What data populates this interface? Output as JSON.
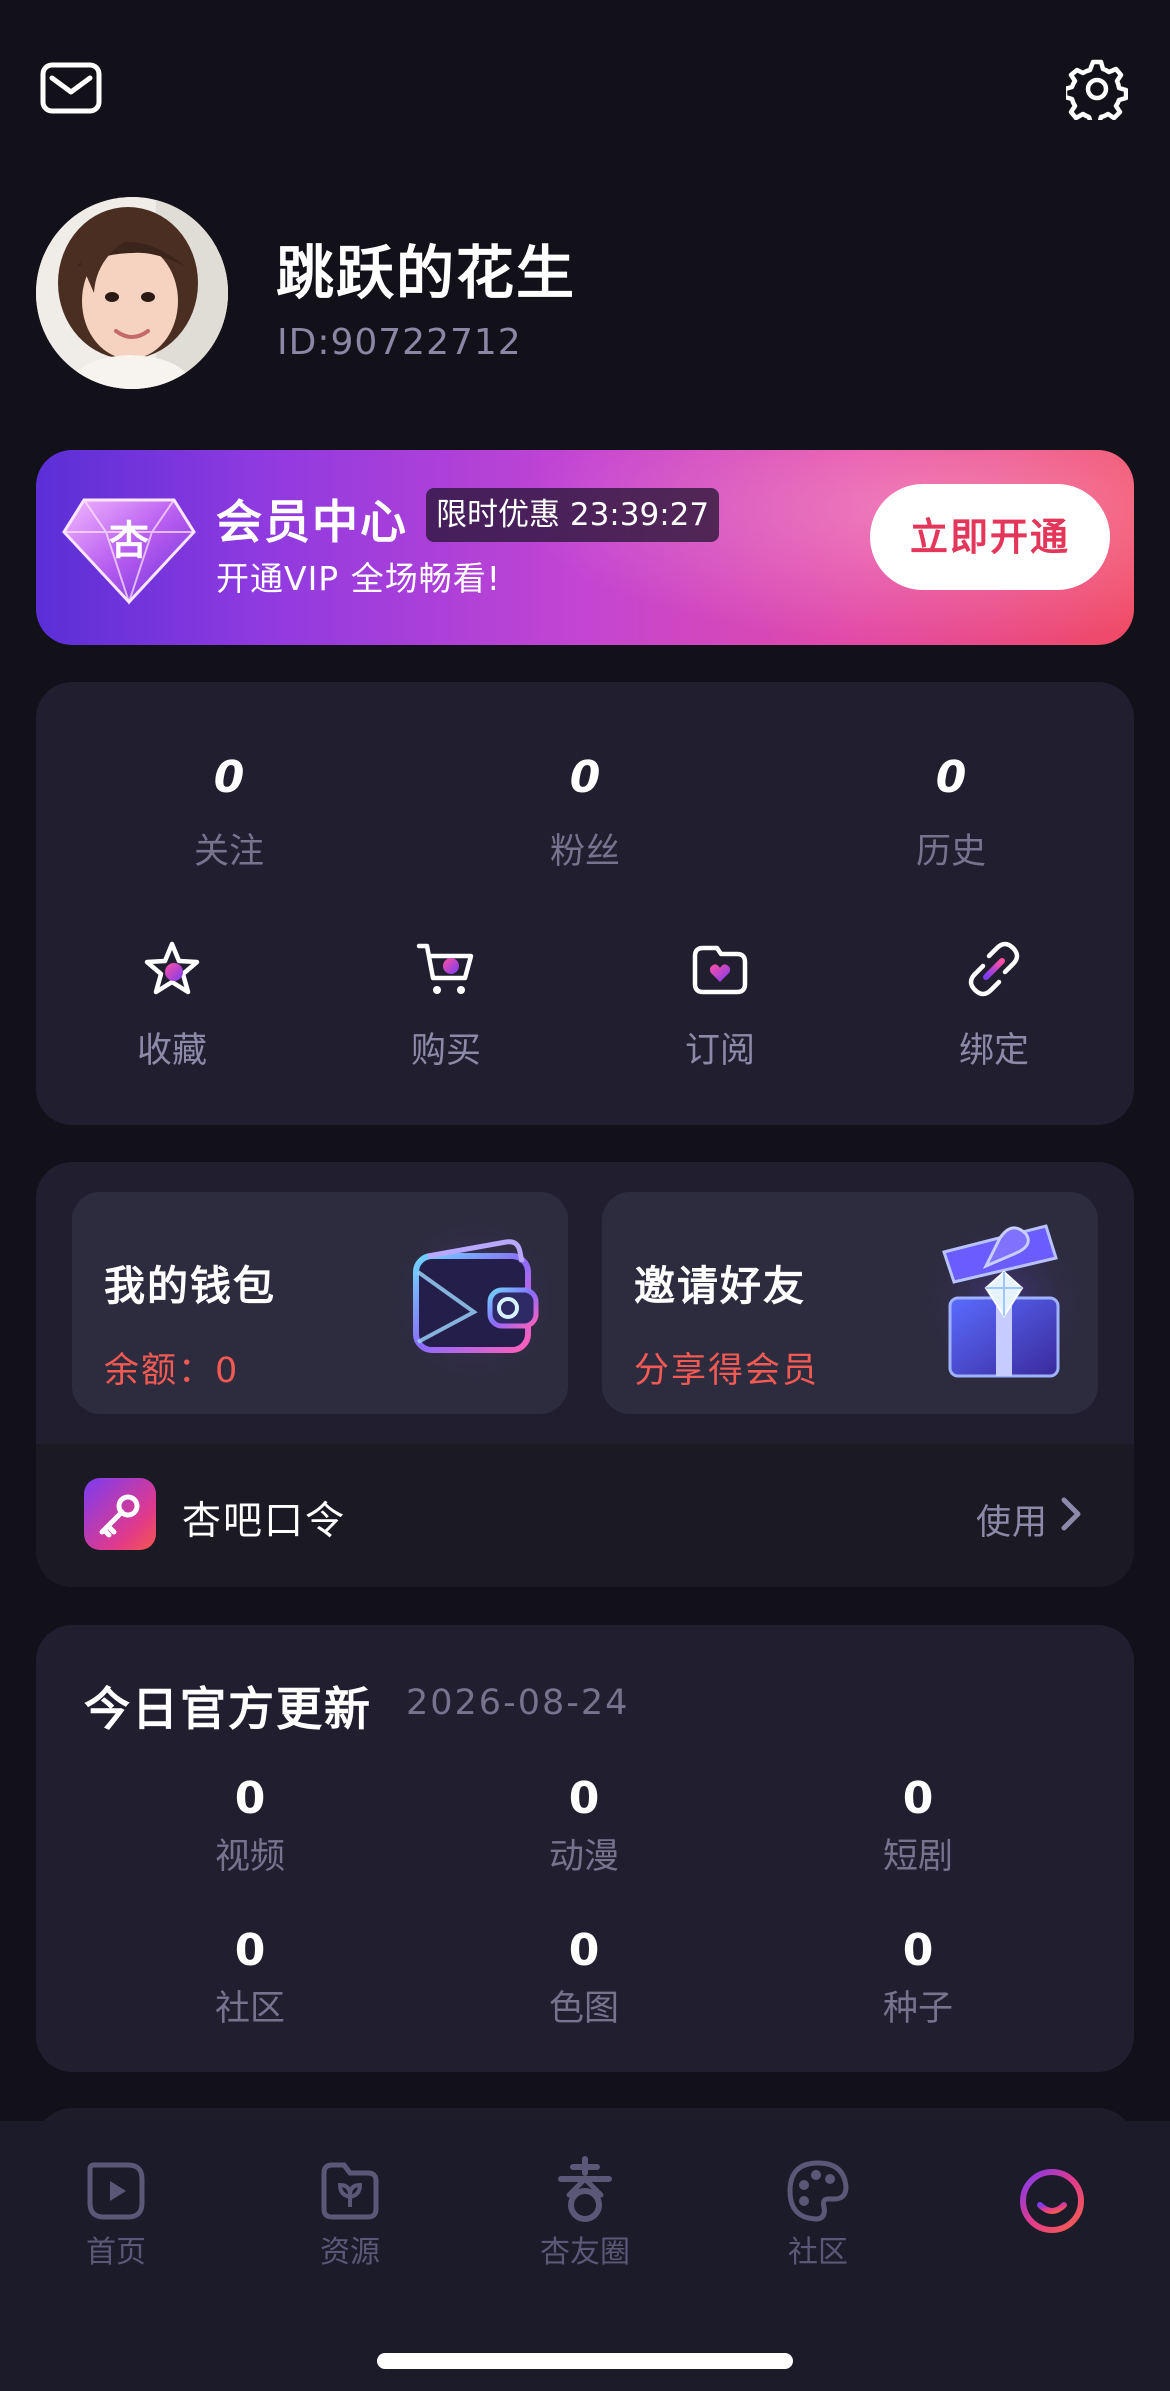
{
  "header": {
    "mail_icon": "mail-icon",
    "settings_icon": "gear-icon"
  },
  "profile": {
    "username": "跳跃的花生",
    "user_id": "ID:90722712"
  },
  "vip": {
    "title": "会员中心",
    "promo": "限时优惠 23:39:27",
    "subtitle": "开通VIP 全场畅看!",
    "button": "立即开通",
    "badge_char": "杏"
  },
  "stats": [
    {
      "value": "0",
      "label": "关注"
    },
    {
      "value": "0",
      "label": "粉丝"
    },
    {
      "value": "0",
      "label": "历史"
    }
  ],
  "quick_actions": [
    {
      "label": "收藏",
      "icon": "star-icon"
    },
    {
      "label": "购买",
      "icon": "cart-icon"
    },
    {
      "label": "订阅",
      "icon": "subscribe-icon"
    },
    {
      "label": "绑定",
      "icon": "link-icon"
    }
  ],
  "wallet": {
    "title": "我的钱包",
    "balance": "余额：0"
  },
  "invite": {
    "title": "邀请好友",
    "desc": "分享得会员"
  },
  "command": {
    "label": "杏吧口令",
    "action": "使用"
  },
  "updates": {
    "title": "今日官方更新",
    "date": "2026-08-24",
    "items": [
      {
        "value": "0",
        "label": "视频"
      },
      {
        "value": "0",
        "label": "动漫"
      },
      {
        "value": "0",
        "label": "短剧"
      },
      {
        "value": "0",
        "label": "社区"
      },
      {
        "value": "0",
        "label": "色图"
      },
      {
        "value": "0",
        "label": "种子"
      }
    ]
  },
  "nav": [
    {
      "label": "首页",
      "icon": "play-icon"
    },
    {
      "label": "资源",
      "icon": "folder-leaf-icon"
    },
    {
      "label": "杏友圈",
      "icon": "apricot-icon"
    },
    {
      "label": "社区",
      "icon": "palette-icon"
    },
    {
      "label": "",
      "icon": "smile-icon",
      "active": true
    }
  ],
  "colors": {
    "accent_red": "#e3365a",
    "orange_text": "#f25a53",
    "muted": "#77738f",
    "card": "#201e2f",
    "bg": "#121119"
  }
}
